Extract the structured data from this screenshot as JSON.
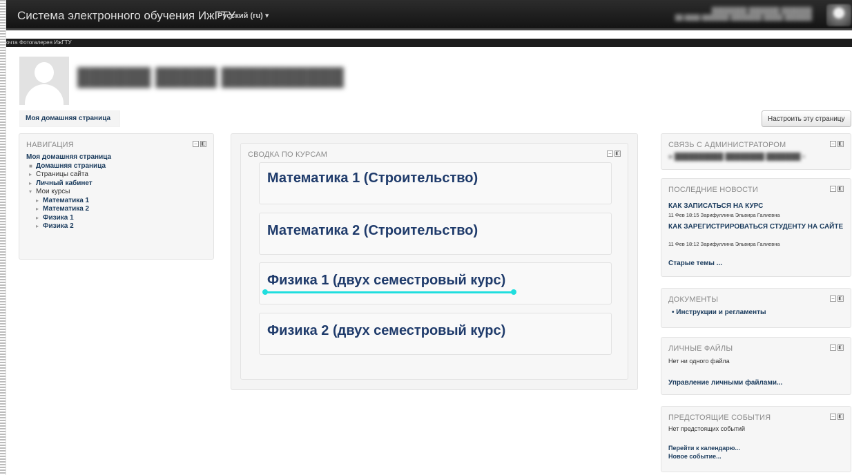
{
  "header": {
    "site_title": "Система электронного обучения ИжГТУ",
    "language": "Русский (ru) ▾"
  },
  "subnav": {
    "items": [
      "очта",
      "Фотогалерея ИжГТУ"
    ]
  },
  "profile": {
    "tab_label": "Моя домашняя страница"
  },
  "toolbar": {
    "customize_label": "Настроить эту страницу"
  },
  "navigation": {
    "title": "НАВИГАЦИЯ",
    "items": [
      {
        "label": "Моя домашняя страница",
        "marker": ""
      },
      {
        "label": "Домашняя страница",
        "marker": "■"
      },
      {
        "label": "Страницы сайта",
        "marker": "▸"
      },
      {
        "label": "Личный кабинет",
        "marker": "▸"
      },
      {
        "label": "Мои курсы",
        "marker": "▾"
      },
      {
        "label": "Математика 1",
        "marker": "▸"
      },
      {
        "label": "Математика 2",
        "marker": "▸"
      },
      {
        "label": "Физика 1",
        "marker": "▸"
      },
      {
        "label": "Физика 2",
        "marker": "▸"
      }
    ]
  },
  "overview": {
    "title": "СВОДКА ПО КУРСАМ",
    "courses": [
      "Математика 1 (Строительство)",
      "Математика 2 (Строительство)",
      "Физика 1 (двух семестровый курс)",
      "Физика 2 (двух семестровый курс)"
    ]
  },
  "admin_block": {
    "title": "СВЯЗЬ С АДМИНИСТРАТОРОМ"
  },
  "news_block": {
    "title": "ПОСЛЕДНИЕ НОВОСТИ",
    "items": [
      {
        "title": "КАК ЗАПИСАТЬСЯ НА КУРС",
        "meta": "11 Фев 18:15 Зарифуллина Эльвира Галиевна"
      },
      {
        "title": "КАК ЗАРЕГИСТРИРОВАТЬСЯ СТУДЕНТУ НА САЙТЕ",
        "meta": "11 Фев 18:12 Зарифуллина Эльвира Галиевна"
      }
    ],
    "older_link": "Старые темы ..."
  },
  "docs_block": {
    "title": "ДОКУМЕНТЫ",
    "item": "Инструкции и регламенты"
  },
  "files_block": {
    "title": "ЛИЧНЫЕ ФАЙЛЫ",
    "empty": "Нет ни одного файла",
    "manage_link": "Управление личными файлами..."
  },
  "events_block": {
    "title": "ПРЕДСТОЯЩИЕ СОБЫТИЯ",
    "empty": "Нет предстоящих событий",
    "calendar_link": "Перейти к календарю...",
    "new_event_link": "Новое событие..."
  }
}
